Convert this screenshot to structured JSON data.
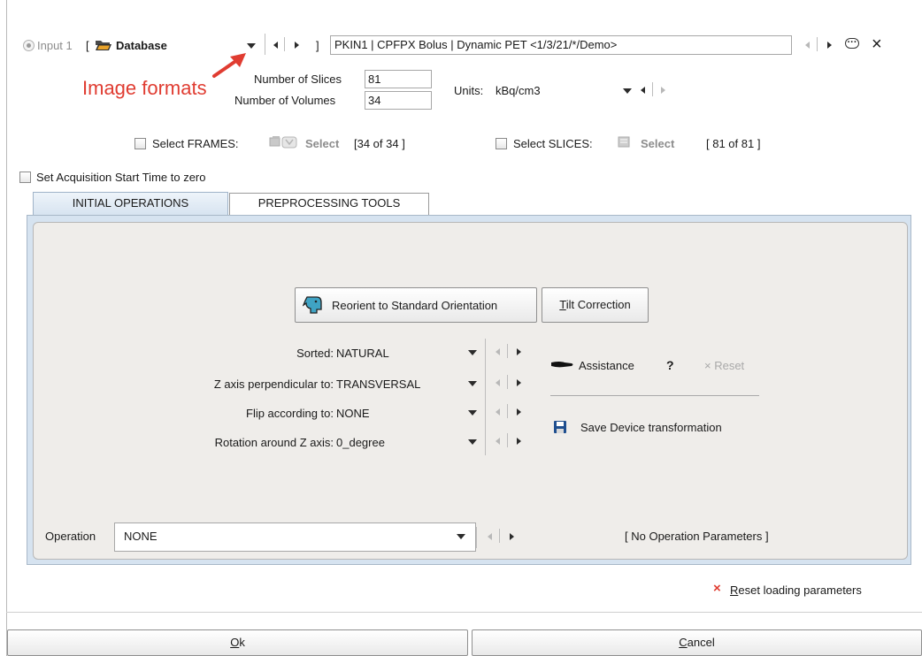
{
  "input": {
    "radio_label": "Input 1",
    "bracket_open": "[",
    "source": "Database",
    "bracket_close": "]",
    "path": "PKIN1 | CPFPX Bolus | Dynamic PET <1/3/21/*/Demo>",
    "more_button": "···",
    "close_button": "×"
  },
  "annotation": {
    "text": "Image formats",
    "color": "#e03c31"
  },
  "slices": {
    "label": "Number of Slices",
    "value": "81"
  },
  "volumes": {
    "label": "Number of Volumes",
    "value": "34"
  },
  "units": {
    "label": "Units:",
    "value": "kBq/cm3"
  },
  "frames": {
    "checkbox_label": "Select FRAMES:",
    "select_label": "Select",
    "count": "[34 of 34 ]"
  },
  "slice_select": {
    "checkbox_label": "Select SLICES:",
    "select_label": "Select",
    "count": "[ 81 of 81 ]"
  },
  "acq_zero": {
    "label": "Set Acquisition Start Time to zero"
  },
  "tabs": [
    {
      "label": "INITIAL OPERATIONS",
      "active": true
    },
    {
      "label": "PREPROCESSING TOOLS",
      "active": false
    }
  ],
  "buttons": {
    "reorient": "Reorient to Standard Orientation",
    "tilt_mnemonic": "T",
    "tilt_rest": "ilt Correction",
    "assistance": "Assistance",
    "help": "?",
    "reset": "× Reset",
    "save_device": "Save Device transformation",
    "reset_loading_mnemonic": "R",
    "reset_loading_rest": "eset loading parameters",
    "ok_mnemonic": "O",
    "ok_rest": "k",
    "cancel_mnemonic": "C",
    "cancel_rest": "ancel"
  },
  "params": [
    {
      "label": "Sorted:",
      "value": "NATURAL"
    },
    {
      "label": "Z axis perpendicular to:",
      "value": "TRANSVERSAL"
    },
    {
      "label": "Flip according to:",
      "value": "NONE"
    },
    {
      "label": "Rotation around Z axis:",
      "value": "0_degree"
    }
  ],
  "operation": {
    "label": "Operation",
    "value": "NONE",
    "params_text": "[ No Operation Parameters ]"
  },
  "colors": {
    "panel_bg": "#efedea",
    "tab_active": "#d6e3f0",
    "accent_red": "#e03c31",
    "disk_blue": "#1f4f8f"
  }
}
